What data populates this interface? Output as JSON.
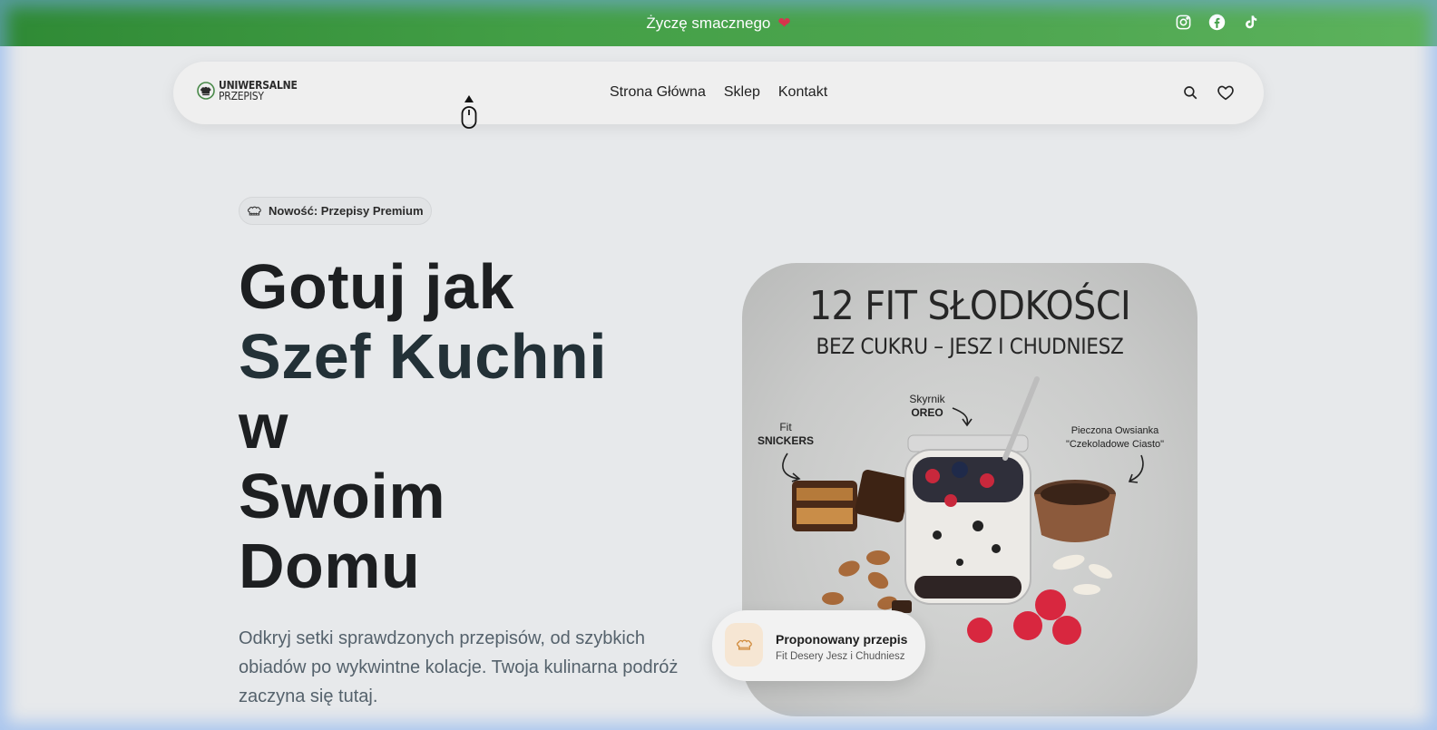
{
  "topbar": {
    "message": "Życzę smacznego",
    "heart": "❤",
    "social_icons": [
      "instagram-icon",
      "facebook-icon",
      "tiktok-icon"
    ]
  },
  "nav": {
    "logo_line1": "UNIWERSALNE",
    "logo_line2": "PRZEPISY",
    "links": [
      "Strona Główna",
      "Sklep",
      "Kontakt"
    ],
    "icons": [
      "search-icon",
      "heart-icon"
    ]
  },
  "hero": {
    "badge": "Nowość: Przepisy Premium",
    "headline_lines": [
      "Gotuj jak",
      "Szef Kuchni",
      "w",
      "Swoim",
      "Domu"
    ],
    "lead": "Odkryj setki sprawdzonych przepisów, od szybkich obiadów po wykwintne kolacje. Twoja kulinarna podróż zaczyna się tutaj."
  },
  "image": {
    "title": "12 FIT SŁODKOŚCI",
    "subtitle": "BEZ CUKRU – JESZ I CHUDNIESZ",
    "label_snickers_1": "Fit",
    "label_snickers_2": "SNICKERS",
    "label_skyr_1": "Skyrnik",
    "label_skyr_2": "OREO",
    "label_owsianka_1": "Pieczona Owsianka",
    "label_owsianka_2": "\"Czekoladowe Ciasto\""
  },
  "suggest": {
    "title": "Proponowany przepis",
    "subtitle": "Fit Desery Jesz i Chudniesz"
  },
  "colors": {
    "topbar_green": "#44a047",
    "heading": "#1d1f21",
    "lead": "#55626c"
  }
}
